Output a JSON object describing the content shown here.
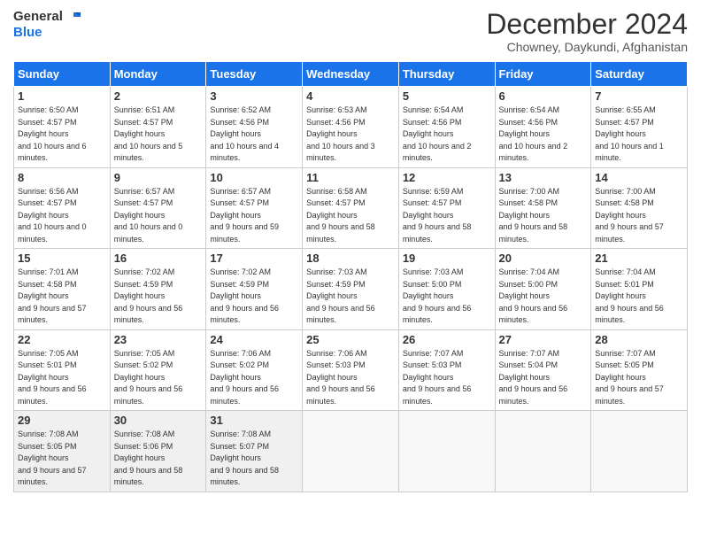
{
  "logo": {
    "line1": "General",
    "line2": "Blue"
  },
  "title": "December 2024",
  "location": "Chowney, Daykundi, Afghanistan",
  "days_of_week": [
    "Sunday",
    "Monday",
    "Tuesday",
    "Wednesday",
    "Thursday",
    "Friday",
    "Saturday"
  ],
  "weeks": [
    [
      {
        "num": "1",
        "sunrise": "6:50 AM",
        "sunset": "4:57 PM",
        "daylight": "10 hours and 6 minutes."
      },
      {
        "num": "2",
        "sunrise": "6:51 AM",
        "sunset": "4:57 PM",
        "daylight": "10 hours and 5 minutes."
      },
      {
        "num": "3",
        "sunrise": "6:52 AM",
        "sunset": "4:56 PM",
        "daylight": "10 hours and 4 minutes."
      },
      {
        "num": "4",
        "sunrise": "6:53 AM",
        "sunset": "4:56 PM",
        "daylight": "10 hours and 3 minutes."
      },
      {
        "num": "5",
        "sunrise": "6:54 AM",
        "sunset": "4:56 PM",
        "daylight": "10 hours and 2 minutes."
      },
      {
        "num": "6",
        "sunrise": "6:54 AM",
        "sunset": "4:56 PM",
        "daylight": "10 hours and 2 minutes."
      },
      {
        "num": "7",
        "sunrise": "6:55 AM",
        "sunset": "4:57 PM",
        "daylight": "10 hours and 1 minute."
      }
    ],
    [
      {
        "num": "8",
        "sunrise": "6:56 AM",
        "sunset": "4:57 PM",
        "daylight": "10 hours and 0 minutes."
      },
      {
        "num": "9",
        "sunrise": "6:57 AM",
        "sunset": "4:57 PM",
        "daylight": "10 hours and 0 minutes."
      },
      {
        "num": "10",
        "sunrise": "6:57 AM",
        "sunset": "4:57 PM",
        "daylight": "9 hours and 59 minutes."
      },
      {
        "num": "11",
        "sunrise": "6:58 AM",
        "sunset": "4:57 PM",
        "daylight": "9 hours and 58 minutes."
      },
      {
        "num": "12",
        "sunrise": "6:59 AM",
        "sunset": "4:57 PM",
        "daylight": "9 hours and 58 minutes."
      },
      {
        "num": "13",
        "sunrise": "7:00 AM",
        "sunset": "4:58 PM",
        "daylight": "9 hours and 58 minutes."
      },
      {
        "num": "14",
        "sunrise": "7:00 AM",
        "sunset": "4:58 PM",
        "daylight": "9 hours and 57 minutes."
      }
    ],
    [
      {
        "num": "15",
        "sunrise": "7:01 AM",
        "sunset": "4:58 PM",
        "daylight": "9 hours and 57 minutes."
      },
      {
        "num": "16",
        "sunrise": "7:02 AM",
        "sunset": "4:59 PM",
        "daylight": "9 hours and 56 minutes."
      },
      {
        "num": "17",
        "sunrise": "7:02 AM",
        "sunset": "4:59 PM",
        "daylight": "9 hours and 56 minutes."
      },
      {
        "num": "18",
        "sunrise": "7:03 AM",
        "sunset": "4:59 PM",
        "daylight": "9 hours and 56 minutes."
      },
      {
        "num": "19",
        "sunrise": "7:03 AM",
        "sunset": "5:00 PM",
        "daylight": "9 hours and 56 minutes."
      },
      {
        "num": "20",
        "sunrise": "7:04 AM",
        "sunset": "5:00 PM",
        "daylight": "9 hours and 56 minutes."
      },
      {
        "num": "21",
        "sunrise": "7:04 AM",
        "sunset": "5:01 PM",
        "daylight": "9 hours and 56 minutes."
      }
    ],
    [
      {
        "num": "22",
        "sunrise": "7:05 AM",
        "sunset": "5:01 PM",
        "daylight": "9 hours and 56 minutes."
      },
      {
        "num": "23",
        "sunrise": "7:05 AM",
        "sunset": "5:02 PM",
        "daylight": "9 hours and 56 minutes."
      },
      {
        "num": "24",
        "sunrise": "7:06 AM",
        "sunset": "5:02 PM",
        "daylight": "9 hours and 56 minutes."
      },
      {
        "num": "25",
        "sunrise": "7:06 AM",
        "sunset": "5:03 PM",
        "daylight": "9 hours and 56 minutes."
      },
      {
        "num": "26",
        "sunrise": "7:07 AM",
        "sunset": "5:03 PM",
        "daylight": "9 hours and 56 minutes."
      },
      {
        "num": "27",
        "sunrise": "7:07 AM",
        "sunset": "5:04 PM",
        "daylight": "9 hours and 56 minutes."
      },
      {
        "num": "28",
        "sunrise": "7:07 AM",
        "sunset": "5:05 PM",
        "daylight": "9 hours and 57 minutes."
      }
    ],
    [
      {
        "num": "29",
        "sunrise": "7:08 AM",
        "sunset": "5:05 PM",
        "daylight": "9 hours and 57 minutes."
      },
      {
        "num": "30",
        "sunrise": "7:08 AM",
        "sunset": "5:06 PM",
        "daylight": "9 hours and 58 minutes."
      },
      {
        "num": "31",
        "sunrise": "7:08 AM",
        "sunset": "5:07 PM",
        "daylight": "9 hours and 58 minutes."
      },
      null,
      null,
      null,
      null
    ]
  ],
  "labels": {
    "sunrise": "Sunrise:",
    "sunset": "Sunset:",
    "daylight": "Daylight:"
  }
}
